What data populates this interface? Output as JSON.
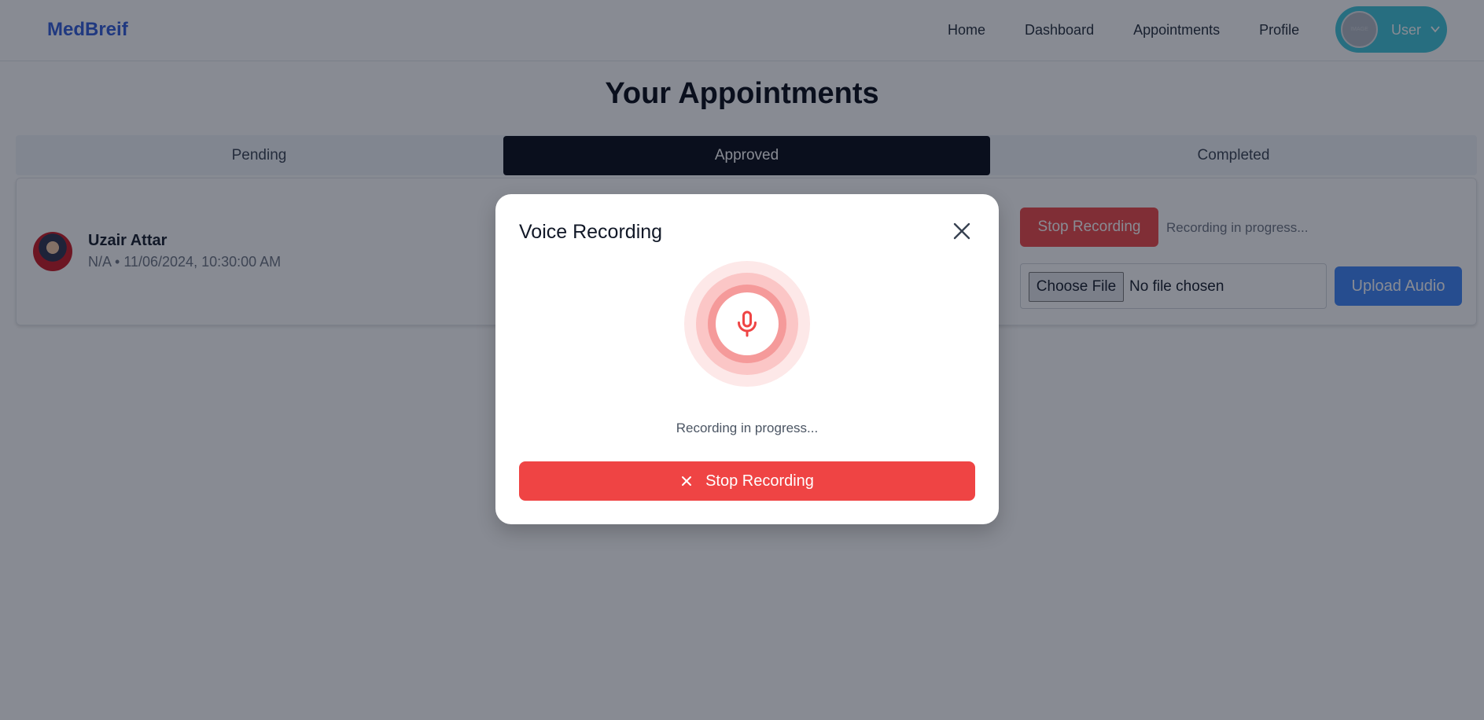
{
  "header": {
    "brand": "MedBreif",
    "nav": [
      "Home",
      "Dashboard",
      "Appointments",
      "Profile"
    ],
    "user_label": "User",
    "avatar_alt": "IMAGE"
  },
  "page": {
    "title": "Your Appointments",
    "tabs": [
      "Pending",
      "Approved",
      "Completed"
    ],
    "active_tab": "Approved"
  },
  "appointment": {
    "patient_name": "Uzair Attar",
    "meta": "N/A • 11/06/2024, 10:30:00 AM",
    "stop_label": "Stop Recording",
    "status": "Recording in progress...",
    "file_button": "Choose File",
    "file_status": "No file chosen",
    "upload_label": "Upload Audio"
  },
  "modal": {
    "title": "Voice Recording",
    "status": "Recording in progress...",
    "stop_label": "Stop Recording"
  },
  "colors": {
    "brand": "#2f5ad8",
    "danger": "#ef4444",
    "primary": "#3b82f6",
    "user_pill": "#3cc5d8",
    "active_tab": "#030712"
  },
  "icons": [
    "chevron-down-icon",
    "mic-icon",
    "close-icon",
    "x-icon"
  ]
}
